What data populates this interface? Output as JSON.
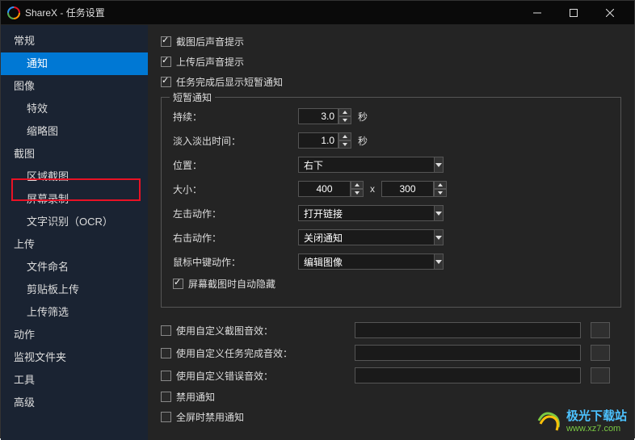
{
  "window": {
    "title": "ShareX - 任务设置"
  },
  "sidebar": {
    "items": [
      {
        "label": "常规",
        "sub": false
      },
      {
        "label": "通知",
        "sub": true,
        "active": true
      },
      {
        "label": "图像",
        "sub": false
      },
      {
        "label": "特效",
        "sub": true
      },
      {
        "label": "缩略图",
        "sub": true
      },
      {
        "label": "截图",
        "sub": false
      },
      {
        "label": "区域截图",
        "sub": true
      },
      {
        "label": "屏幕录制",
        "sub": true
      },
      {
        "label": "文字识别（OCR）",
        "sub": true,
        "highlighted": true
      },
      {
        "label": "上传",
        "sub": false
      },
      {
        "label": "文件命名",
        "sub": true
      },
      {
        "label": "剪贴板上传",
        "sub": true
      },
      {
        "label": "上传筛选",
        "sub": true
      },
      {
        "label": "动作",
        "sub": false
      },
      {
        "label": "监视文件夹",
        "sub": false
      },
      {
        "label": "工具",
        "sub": false
      },
      {
        "label": "高级",
        "sub": false
      }
    ]
  },
  "main": {
    "cb_capture_sound": "截图后声音提示",
    "cb_upload_sound": "上传后声音提示",
    "cb_task_toast": "任务完成后显示短暂通知",
    "toast_legend": "短暂通知",
    "duration_label": "持续：",
    "duration_value": "3.0",
    "fade_label": "淡入淡出时间：",
    "fade_value": "1.0",
    "seconds": "秒",
    "position_label": "位置：",
    "position_value": "右下",
    "size_label": "大小：",
    "size_w": "400",
    "size_h": "300",
    "size_x": "x",
    "left_click_label": "左击动作：",
    "left_click_value": "打开链接",
    "right_click_label": "右击动作：",
    "right_click_value": "关闭通知",
    "middle_click_label": "鼠标中键动作：",
    "middle_click_value": "编辑图像",
    "cb_auto_hide": "屏幕截图时自动隐藏",
    "cb_custom_capture": "使用自定义截图音效：",
    "cb_custom_task": "使用自定义任务完成音效：",
    "cb_custom_error": "使用自定义错误音效：",
    "cb_disable_notif": "禁用通知",
    "cb_disable_fullscreen": "全屏时禁用通知"
  },
  "watermark": {
    "brand": "极光下载站",
    "url": "www.xz7.com"
  }
}
